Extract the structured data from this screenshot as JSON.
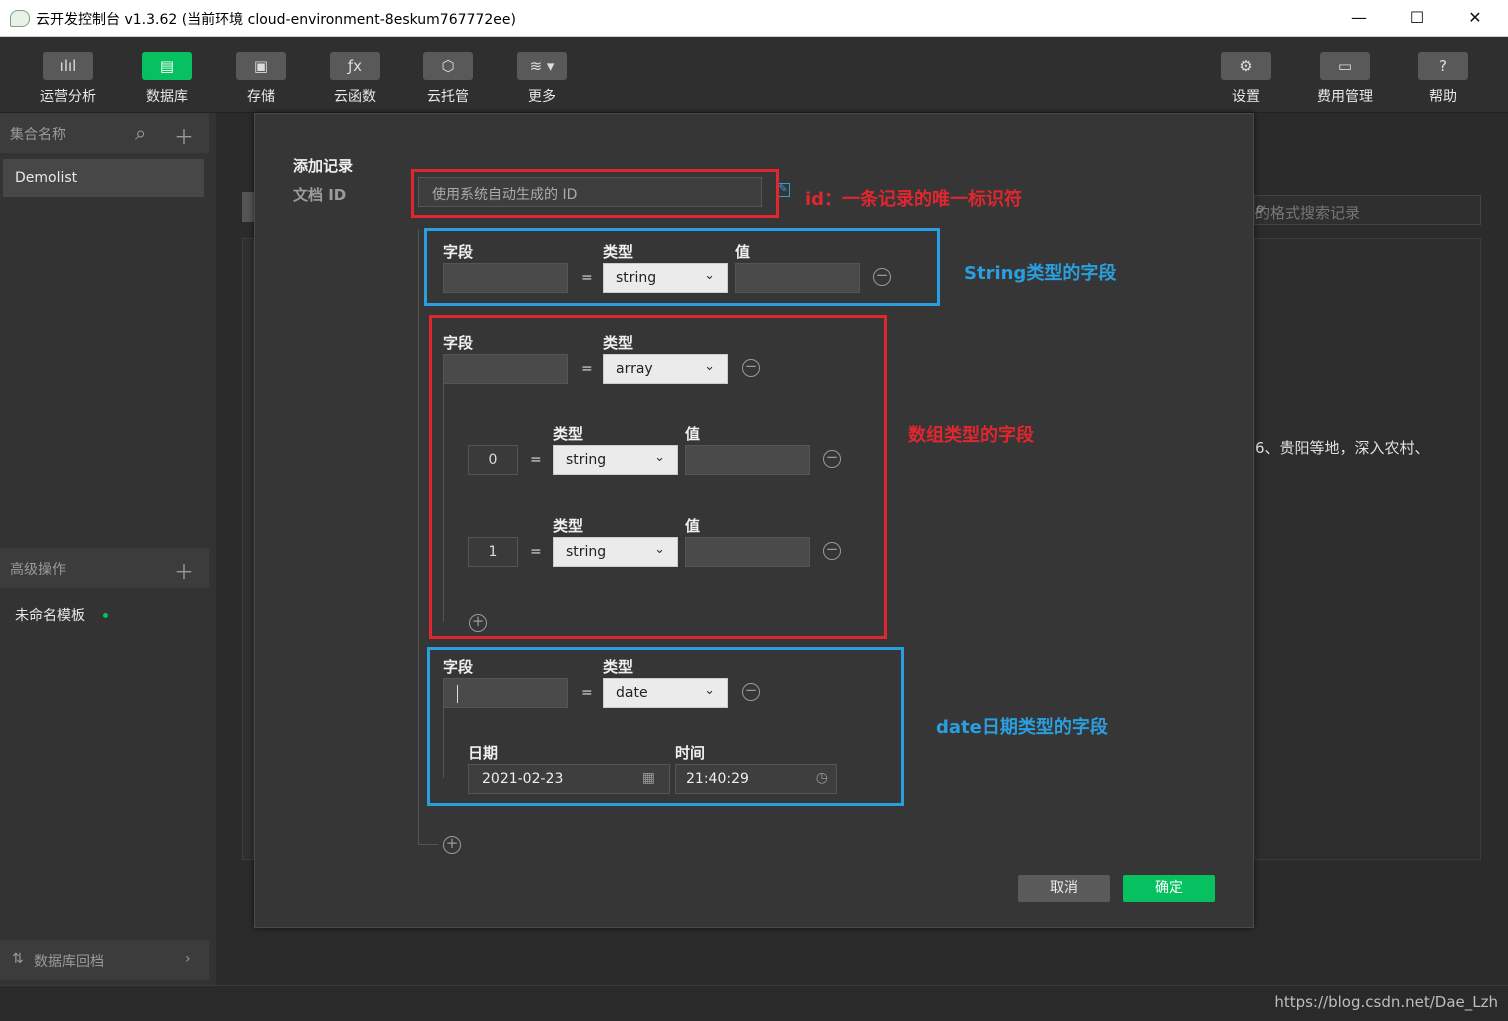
{
  "window": {
    "title": "云开发控制台 v1.3.62 (当前环境 cloud-environment-8eskum767772ee)",
    "controls": [
      "—",
      "☐",
      "✕"
    ]
  },
  "toolbar": {
    "left": [
      {
        "label": "运营分析",
        "icon": "bar-chart-icon",
        "glyph": "ılıl"
      },
      {
        "label": "数据库",
        "icon": "database-icon",
        "glyph": "▤",
        "active": true
      },
      {
        "label": "存储",
        "icon": "storage-icon",
        "glyph": "▣"
      },
      {
        "label": "云函数",
        "icon": "function-icon",
        "glyph": "ƒx"
      },
      {
        "label": "云托管",
        "icon": "cube-icon",
        "glyph": "⬡"
      },
      {
        "label": "更多",
        "icon": "layers-icon",
        "glyph": "≋ ▾"
      }
    ],
    "right": [
      {
        "label": "设置",
        "icon": "gear-icon",
        "glyph": "⚙"
      },
      {
        "label": "费用管理",
        "icon": "billing-icon",
        "glyph": "▭"
      },
      {
        "label": "帮助",
        "icon": "help-icon",
        "glyph": "?"
      }
    ]
  },
  "sidebar": {
    "collections_header": "集合名称",
    "collections": [
      "Demolist"
    ],
    "advanced_header": "高级操作",
    "template_name": "未命名模板",
    "rollback": "数据库回档"
  },
  "background": {
    "search_placeholder": "的格式搜索记录",
    "content_snippet": "6、贵阳等地，深入农村、"
  },
  "dialog": {
    "title": "添加记录",
    "doc_id_label": "文档 ID",
    "doc_id_placeholder": "使用系统自动生成的 ID",
    "field_label": "字段",
    "type_label": "类型",
    "value_label": "值",
    "field1": {
      "type": "string"
    },
    "field2": {
      "type": "array",
      "items": [
        {
          "index": "0",
          "type": "string"
        },
        {
          "index": "1",
          "type": "string"
        }
      ]
    },
    "field3": {
      "type": "date",
      "date_label": "日期",
      "time_label": "时间",
      "date_value": "2021-02-23",
      "time_value": "21:40:29"
    },
    "cancel": "取消",
    "confirm": "确定"
  },
  "annotations": {
    "id": "id：一条记录的唯一标识符",
    "string": "String类型的字段",
    "array": "数组类型的字段",
    "date": "date日期类型的字段"
  },
  "watermark": "https://blog.csdn.net/Dae_Lzh",
  "colors": {
    "accent": "#07c160",
    "red": "#e0262e",
    "blue": "#2a9fe0"
  }
}
